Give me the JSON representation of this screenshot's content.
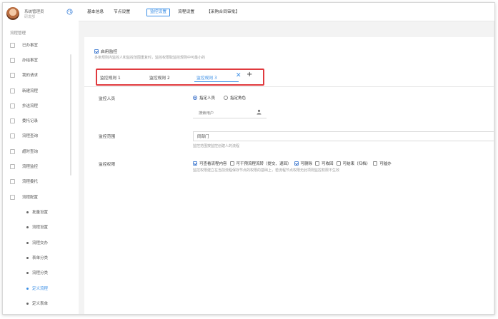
{
  "user": {
    "name": "系统管理员",
    "org": "研发部"
  },
  "nav": {
    "section_title": "流程管理",
    "items": [
      {
        "label": "已办事宜"
      },
      {
        "label": "办结事宜"
      },
      {
        "label": "我的请求"
      },
      {
        "label": "新建流程"
      },
      {
        "label": "抄送流程"
      },
      {
        "label": "委托记录"
      },
      {
        "label": "流程查询"
      },
      {
        "label": "超时查询"
      },
      {
        "label": "流程监控"
      },
      {
        "label": "流程委托"
      },
      {
        "label": "流程配置"
      }
    ],
    "sub_items": [
      {
        "label": "批量设置"
      },
      {
        "label": "流程设置"
      },
      {
        "label": "流程交办"
      },
      {
        "label": "表单分类"
      },
      {
        "label": "流程分类"
      },
      {
        "label": "定义流程",
        "active": true
      },
      {
        "label": "定义表单"
      }
    ]
  },
  "top_tabs": [
    {
      "label": "基本信息"
    },
    {
      "label": "节点设置"
    },
    {
      "label": "监控设置",
      "active": true
    },
    {
      "label": "流程设置"
    },
    {
      "label": "【采购合同审批】"
    }
  ],
  "monitor": {
    "enable_label": "启用监控",
    "enable_hint": "多条规则内监控人和监控范围重复时，监控权限取监控规则中可最小的",
    "rules": [
      {
        "label": "监控规则 1"
      },
      {
        "label": "监控规则 2"
      },
      {
        "label": "监控规则 3",
        "active": true
      }
    ],
    "close_symbol": "✕",
    "add_symbol": "+",
    "monitor_person_label": "监控人员",
    "radio_options": [
      "指定人员",
      "指定角色"
    ],
    "user_placeholder": "搜索用户",
    "range_label": "监控范围",
    "range_value": "同部门",
    "range_hint": "监控范围按监控创建人的流程",
    "permission_label": "监控权限",
    "permissions": [
      {
        "label": "可查看流程内容",
        "checked": true
      },
      {
        "label": "可干预流程流转（提交、退回）",
        "checked": false
      },
      {
        "label": "可删除",
        "checked": true
      },
      {
        "label": "可收回",
        "checked": false
      },
      {
        "label": "可结束（归档）",
        "checked": false
      },
      {
        "label": "可催办",
        "checked": false
      }
    ],
    "permission_hint": "监控权限建立在当前流程保存节点的权限的基础上，若流程节点权限无此项则监控权限不生效"
  },
  "colors": {
    "accent": "#3a8ee6",
    "highlight_box": "#e0393e"
  }
}
